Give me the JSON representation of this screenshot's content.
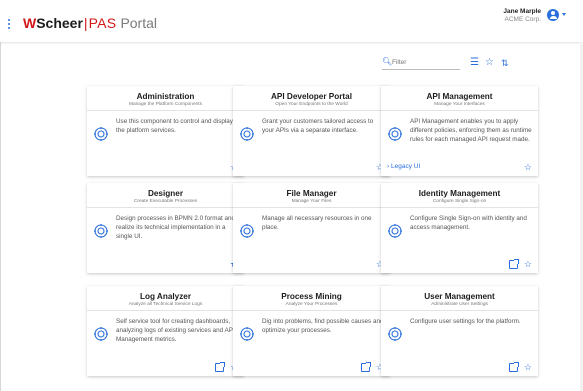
{
  "header": {
    "logo_mark": "W",
    "brand": "Scheer",
    "separator": "|",
    "product": "PAS",
    "portal": "Portal",
    "user_name": "Jane Marple",
    "user_org": "ACME Corp."
  },
  "toolbar": {
    "filter_placeholder": "Filter",
    "list_view_icon": "list-icon",
    "favorites_icon": "star-icon",
    "sort_icon": "sort-icon"
  },
  "colors": {
    "accent": "#2a6fdb",
    "brand_red": "#d3171b"
  },
  "cards": [
    {
      "title": "Administration",
      "subtitle": "Manage the Platform Components",
      "description": "Use this component to control and display the platform services.",
      "icon": "gears-icon",
      "favorite": false,
      "external": false
    },
    {
      "title": "API Developer Portal",
      "subtitle": "Open Your Endpoints to the World",
      "description": "Grant your customers tailored access to your APIs via a separate interface.",
      "icon": "code-gear-icon",
      "favorite": false,
      "external": false
    },
    {
      "title": "API Management",
      "subtitle": "Manage Your Interfaces",
      "description": "API Management enables you to apply different policies, enforcing them as runtime rules for each managed API request made.",
      "icon": "policy-gears-icon",
      "favorite": false,
      "external": false,
      "link": "Legacy UI"
    },
    {
      "title": "Designer",
      "subtitle": "Create Executable Processes",
      "description": "Design processes in BPMN 2.0 format and realize its technical implementation in a single UI.",
      "icon": "process-flow-icon",
      "favorite": true,
      "external": false
    },
    {
      "title": "File Manager",
      "subtitle": "Manage Your Files",
      "description": "Manage all necessary resources in one place.",
      "icon": "file-upload-icon",
      "favorite": false,
      "external": false
    },
    {
      "title": "Identity Management",
      "subtitle": "Configure Single Sign-on",
      "description": "Configure Single Sign-on with identity and access management.",
      "icon": "identity-gears-icon",
      "favorite": false,
      "external": true
    },
    {
      "title": "Log Analyzer",
      "subtitle": "Analyze all Technical Service Logs",
      "description": "Self service tool for creating dashboards, analyzing logs of existing services and API Management metrics.",
      "icon": "log-search-icon",
      "favorite": false,
      "external": true
    },
    {
      "title": "Process Mining",
      "subtitle": "Analyze Your Processes",
      "description": "Dig into problems, find possible causes and optimize your processes.",
      "icon": "chart-magnifier-icon",
      "favorite": false,
      "external": true
    },
    {
      "title": "User Management",
      "subtitle": "Administrate User Settings",
      "description": "Configure user settings for the platform.",
      "icon": "users-icon",
      "favorite": false,
      "external": true
    }
  ]
}
